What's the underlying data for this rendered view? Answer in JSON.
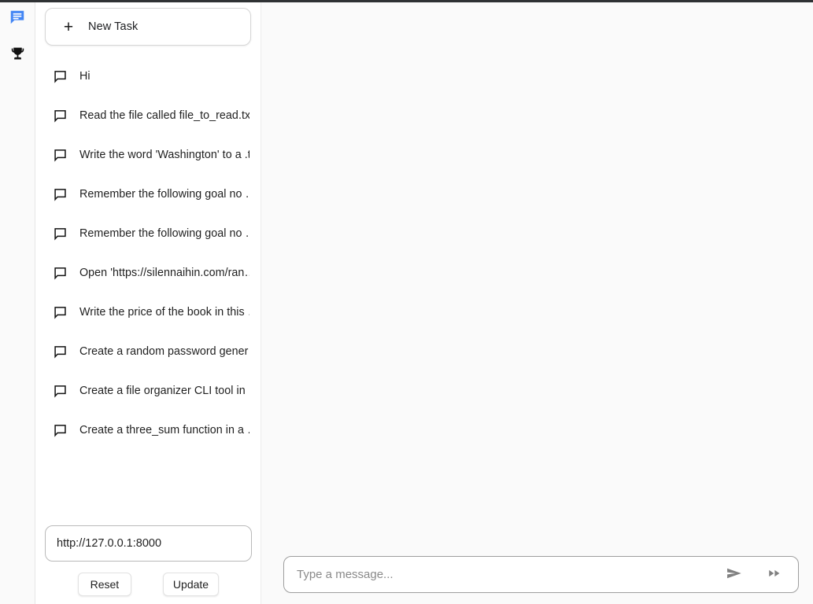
{
  "theme": {
    "accent_blue": "#4285F4",
    "rail_bg": "#fafafa",
    "sidebar_bg": "#ffffff",
    "main_bg": "#fafafa",
    "text": "#1f1f1f",
    "icon_grey": "#808080"
  },
  "rail": {
    "items": [
      {
        "name": "chat-icon",
        "label": "Chats",
        "active": true
      },
      {
        "name": "trophy-icon",
        "label": "Leaderboard",
        "active": false
      }
    ]
  },
  "sidebar": {
    "new_task_label": "New Task",
    "new_task_icon": "plus-icon",
    "plus_glyph": "+",
    "tasks": [
      {
        "label": "Hi",
        "icon": "chat-bubble-icon"
      },
      {
        "label": "Read the file called file_to_read.tx…",
        "icon": "chat-bubble-icon"
      },
      {
        "label": "Write the word 'Washington' to a .t…",
        "icon": "chat-bubble-icon"
      },
      {
        "label": "Remember the following goal no …",
        "icon": "chat-bubble-icon"
      },
      {
        "label": "Remember the following goal no …",
        "icon": "chat-bubble-icon"
      },
      {
        "label": "Open 'https://silennaihin.com/ran…",
        "icon": "chat-bubble-icon"
      },
      {
        "label": "Write the price of the book in this …",
        "icon": "chat-bubble-icon"
      },
      {
        "label": "Create a random password gener…",
        "icon": "chat-bubble-icon"
      },
      {
        "label": "Create a file organizer CLI tool in …",
        "icon": "chat-bubble-icon"
      },
      {
        "label": "Create a three_sum function in a …",
        "icon": "chat-bubble-icon"
      }
    ],
    "url_field": {
      "value": "http://127.0.0.1:8000",
      "placeholder": "http://127.0.0.1:8000"
    },
    "reset_label": "Reset",
    "update_label": "Update"
  },
  "composer": {
    "placeholder": "Type a message...",
    "value": "",
    "send_icon": "send-icon",
    "fast_forward_icon": "fast-forward-icon"
  }
}
